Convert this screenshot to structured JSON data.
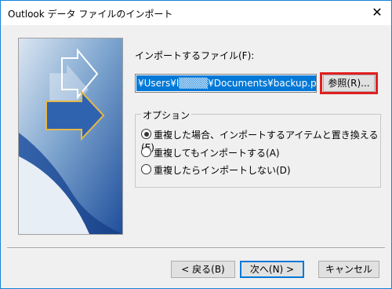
{
  "window": {
    "title": "Outlook データ ファイルのインポート"
  },
  "titlebar": {
    "close_glyph": "✕"
  },
  "file": {
    "label": "インポートするファイル(F):",
    "path": "¥Users¥l▒▒▒▒¥Documents¥backup.pst",
    "browse_label": "参照(R)..."
  },
  "options": {
    "legend": "オプション",
    "items": [
      {
        "label": "重複した場合、インポートするアイテムと置き換える(E)",
        "checked": true
      },
      {
        "label": "重複してもインポートする(A)",
        "checked": false
      },
      {
        "label": "重複したらインポートしない(D)",
        "checked": false
      }
    ]
  },
  "footer": {
    "back_label": "< 戻る(B)",
    "next_label": "次へ(N) >",
    "cancel_label": "キャンセル"
  }
}
